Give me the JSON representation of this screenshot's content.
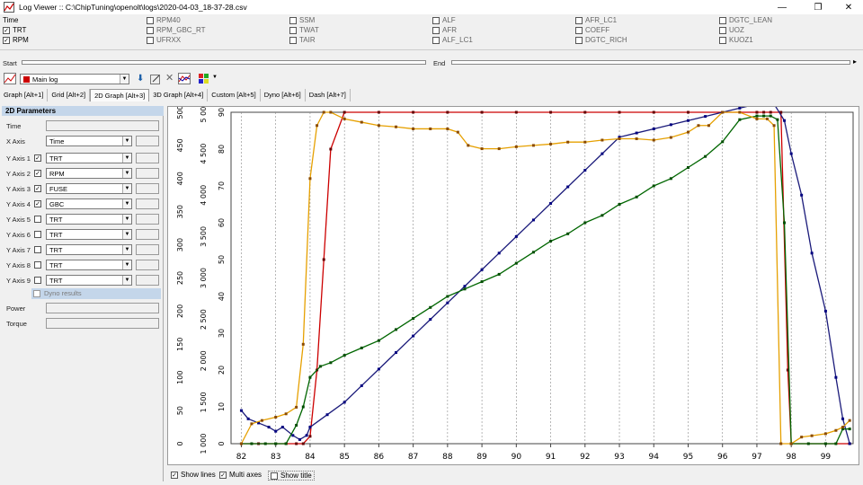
{
  "window": {
    "title": "Log Viewer :: C:\\ChipTuning\\openolt\\logs\\2020-04-03_18-37-28.csv",
    "min": "—",
    "max": "❐",
    "close": "✕"
  },
  "params": [
    {
      "label": "Time",
      "checked": false
    },
    {
      "label": "TRT",
      "checked": true
    },
    {
      "label": "RPM",
      "checked": true
    },
    {
      "label": "RPM40",
      "checked": false
    },
    {
      "label": "RPM_GBC_RT",
      "checked": false
    },
    {
      "label": "UFRXX",
      "checked": false
    },
    {
      "label": "SSM",
      "checked": false
    },
    {
      "label": "TWAT",
      "checked": false
    },
    {
      "label": "TAIR",
      "checked": false
    },
    {
      "label": "ALF",
      "checked": false
    },
    {
      "label": "AFR",
      "checked": false
    },
    {
      "label": "ALF_LC1",
      "checked": false
    },
    {
      "label": "AFR_LC1",
      "checked": false
    },
    {
      "label": "COEFF",
      "checked": false
    },
    {
      "label": "DGTC_RICH",
      "checked": false
    },
    {
      "label": "DGTC_LEAN",
      "checked": false
    },
    {
      "label": "UOZ",
      "checked": false
    },
    {
      "label": "KUOZ1",
      "checked": false
    }
  ],
  "range": {
    "start": "Start",
    "end": "End"
  },
  "toolbar": {
    "log_select": "Main log"
  },
  "tabs": [
    "Graph [Alt+1]",
    "Grid [Alt+2]",
    "2D Graph [Alt+3]",
    "3D Graph [Alt+4]",
    "Custom [Alt+5]",
    "Dyno [Alt+6]",
    "Dash [Alt+7]"
  ],
  "panel": {
    "title": "2D Parameters",
    "time_label": "Time",
    "xaxis_label": "X Axis",
    "xaxis_value": "Time",
    "yaxes": [
      {
        "label": "Y Axis 1",
        "checked": true,
        "value": "TRT"
      },
      {
        "label": "Y Axis 2",
        "checked": true,
        "value": "RPM"
      },
      {
        "label": "Y Axis 3",
        "checked": true,
        "value": "FUSE"
      },
      {
        "label": "Y Axis 4",
        "checked": true,
        "value": "GBC"
      },
      {
        "label": "Y Axis 5",
        "checked": false,
        "value": "TRT"
      },
      {
        "label": "Y Axis 6",
        "checked": false,
        "value": "TRT"
      },
      {
        "label": "Y Axis 7",
        "checked": false,
        "value": "TRT"
      },
      {
        "label": "Y Axis 8",
        "checked": false,
        "value": "TRT"
      },
      {
        "label": "Y Axis 9",
        "checked": false,
        "value": "TRT"
      }
    ],
    "dyno": "Dyno results",
    "power": "Power",
    "torque": "Torque"
  },
  "bottom": {
    "show_lines": "Show lines",
    "multi_axes": "Multi axes",
    "show_title": "Show title"
  },
  "chart_data": {
    "type": "line",
    "xlim": [
      81.7,
      99.8
    ],
    "xticks": [
      82,
      83,
      84,
      85,
      86,
      87,
      88,
      89,
      90,
      91,
      92,
      93,
      94,
      95,
      96,
      97,
      98,
      99
    ],
    "axes": [
      {
        "ticks": [
          "0",
          "50",
          "100",
          "150",
          "200",
          "250",
          "300",
          "350",
          "400",
          "450",
          "500"
        ],
        "range": [
          0,
          500
        ]
      },
      {
        "ticks": [
          "1 000",
          "1 500",
          "2 000",
          "2 500",
          "3 000",
          "3 500",
          "4 000",
          "4 500",
          "5 000"
        ],
        "range": [
          1000,
          5000
        ]
      },
      {
        "ticks": [
          "0",
          "10",
          "20",
          "30",
          "40",
          "50",
          "60",
          "70",
          "80",
          "90"
        ],
        "range": [
          0,
          90
        ]
      }
    ],
    "series": [
      {
        "color": "#cc0000",
        "marker": "#660000",
        "axis": 2,
        "x": [
          82,
          82.5,
          83,
          83.3,
          83.6,
          83.8,
          84,
          84.2,
          84.4,
          84.6,
          85,
          86,
          87,
          88,
          89,
          90,
          91,
          92,
          93,
          94,
          95,
          96,
          97,
          97.2,
          97.4,
          97.7,
          97.9,
          98,
          99,
          99.7
        ],
        "y": [
          0,
          0,
          0,
          0,
          0,
          0,
          2,
          20,
          50,
          80,
          90,
          90,
          90,
          90,
          90,
          90,
          90,
          90,
          90,
          90,
          90,
          90,
          90,
          90,
          90,
          90,
          20,
          0,
          0,
          0
        ]
      },
      {
        "color": "#1a1a7a",
        "marker": "#000080",
        "axis": 1,
        "x": [
          82,
          82.2,
          82.5,
          82.8,
          83,
          83.2,
          83.5,
          83.7,
          83.9,
          84,
          84.5,
          85,
          85.5,
          86,
          86.5,
          87,
          87.5,
          88,
          88.5,
          89,
          89.5,
          90,
          90.5,
          91,
          91.5,
          92,
          92.5,
          93,
          93.5,
          94,
          94.5,
          95,
          95.5,
          96,
          96.5,
          97,
          97.3,
          97.5,
          97.8,
          98,
          98.3,
          98.6,
          99,
          99.3,
          99.5,
          99.7
        ],
        "y": [
          1400,
          1300,
          1250,
          1200,
          1150,
          1200,
          1100,
          1050,
          1100,
          1200,
          1350,
          1500,
          1700,
          1900,
          2100,
          2300,
          2500,
          2700,
          2900,
          3100,
          3300,
          3500,
          3700,
          3900,
          4100,
          4300,
          4500,
          4700,
          4750,
          4800,
          4850,
          4900,
          4950,
          5000,
          5050,
          5100,
          5100,
          5100,
          4900,
          4500,
          4000,
          3300,
          2600,
          1800,
          1300,
          1000
        ]
      },
      {
        "color": "#006600",
        "marker": "#004d00",
        "axis": 2,
        "x": [
          82,
          82.3,
          82.7,
          83,
          83.3,
          83.6,
          83.8,
          84,
          84.3,
          84.6,
          85,
          85.5,
          86,
          86.5,
          87,
          87.5,
          88,
          88.5,
          89,
          89.5,
          90,
          90.5,
          91,
          91.5,
          92,
          92.5,
          93,
          93.5,
          94,
          94.5,
          95,
          95.5,
          96,
          96.5,
          97,
          97.2,
          97.4,
          97.6,
          97.8,
          98,
          98.5,
          99,
          99.3,
          99.5,
          99.7
        ],
        "y": [
          0,
          0,
          0,
          0,
          0,
          5,
          10,
          18,
          21,
          22,
          24,
          26,
          28,
          31,
          34,
          37,
          40,
          42,
          44,
          46,
          49,
          52,
          55,
          57,
          60,
          62,
          65,
          67,
          70,
          72,
          75,
          78,
          82,
          88,
          89,
          89,
          89,
          88,
          60,
          0,
          0,
          0,
          0,
          4,
          4
        ]
      },
      {
        "color": "#e6a000",
        "marker": "#8a4a00",
        "axis": 0,
        "x": [
          82,
          82.3,
          82.6,
          83,
          83.3,
          83.6,
          83.8,
          84,
          84.2,
          84.4,
          84.6,
          85,
          85.5,
          86,
          86.5,
          87,
          87.5,
          88,
          88.3,
          88.6,
          89,
          89.5,
          90,
          90.5,
          91,
          91.5,
          92,
          92.5,
          93,
          93.5,
          94,
          94.5,
          95,
          95.3,
          95.6,
          96,
          96.5,
          97,
          97.3,
          97.5,
          97.7,
          98,
          98.3,
          98.6,
          99,
          99.3,
          99.5,
          99.7
        ],
        "y": [
          0,
          30,
          35,
          40,
          45,
          55,
          150,
          400,
          480,
          500,
          500,
          490,
          485,
          480,
          478,
          475,
          475,
          475,
          470,
          450,
          445,
          445,
          448,
          450,
          452,
          455,
          455,
          458,
          460,
          460,
          458,
          462,
          470,
          480,
          480,
          500,
          500,
          490,
          490,
          480,
          0,
          0,
          10,
          12,
          15,
          20,
          25,
          35
        ]
      }
    ]
  }
}
